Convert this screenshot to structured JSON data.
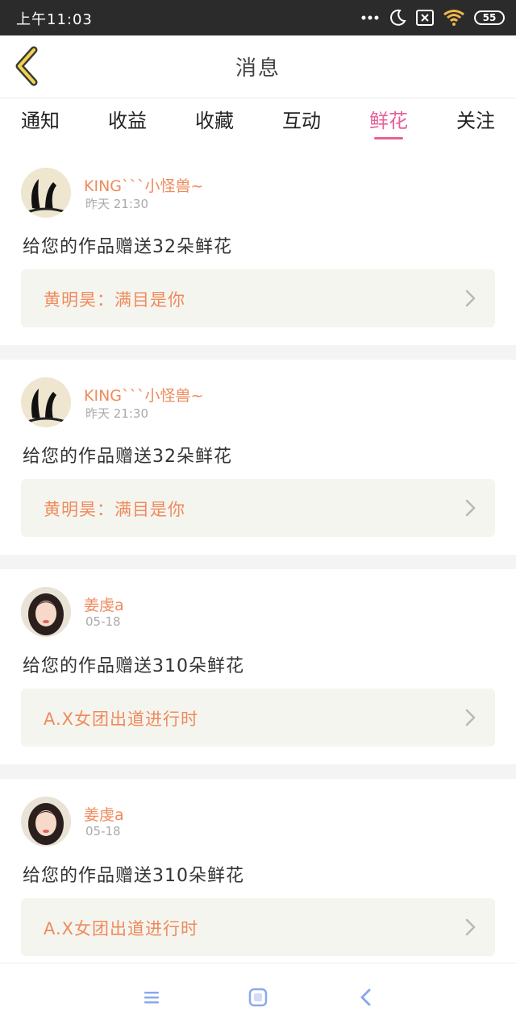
{
  "status_bar": {
    "time": "上午11:03",
    "battery": "55",
    "icons": [
      "more-dots-icon",
      "moon-icon",
      "sim-off-icon",
      "wifi-icon",
      "battery-icon"
    ]
  },
  "header": {
    "title": "消息",
    "back_icon": "chevron-left-icon"
  },
  "tabs": [
    {
      "label": "通知",
      "active": false
    },
    {
      "label": "收益",
      "active": false
    },
    {
      "label": "收藏",
      "active": false
    },
    {
      "label": "互动",
      "active": false
    },
    {
      "label": "鲜花",
      "active": true
    },
    {
      "label": "关注",
      "active": false
    }
  ],
  "messages": [
    {
      "user": "KING```小怪兽~",
      "time": "昨天 21:30",
      "text": "给您的作品赠送32朵鲜花",
      "work_title": "黄明昊：满目是你"
    },
    {
      "user": "KING```小怪兽~",
      "time": "昨天 21:30",
      "text": "给您的作品赠送32朵鲜花",
      "work_title": "黄明昊：满目是你"
    },
    {
      "user": "姜虔a",
      "time": "05-18",
      "text": "给您的作品赠送310朵鲜花",
      "work_title": "A.X女团出道进行时"
    },
    {
      "user": "姜虔a",
      "time": "05-18",
      "text": "给您的作品赠送310朵鲜花",
      "work_title": "A.X女团出道进行时"
    }
  ],
  "colors": {
    "accent": "#e8609a",
    "name": "#ef8a5c",
    "status_bar": "#2b2b2b",
    "system_nav": "#8aa8ee"
  },
  "system_nav": [
    "menu-icon",
    "home-square-icon",
    "back-triangle-icon"
  ]
}
